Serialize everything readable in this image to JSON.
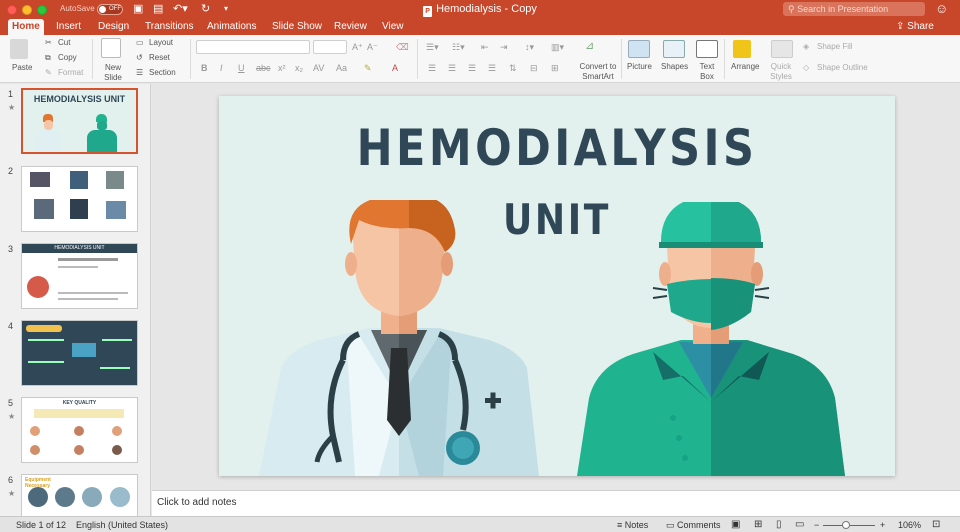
{
  "window": {
    "title": "Hemodialysis - Copy",
    "autosave_label": "AutoSave",
    "autosave_state": "OFF",
    "search_placeholder": "Search in Presentation"
  },
  "tabs": [
    "Home",
    "Insert",
    "Design",
    "Transitions",
    "Animations",
    "Slide Show",
    "Review",
    "View"
  ],
  "share_label": "Share",
  "ribbon": {
    "paste": "Paste",
    "cut": "Cut",
    "copy": "Copy",
    "format": "Format",
    "new_slide": "New Slide",
    "layout": "Layout",
    "reset": "Reset",
    "section": "Section",
    "convert_smartart": "Convert to SmartArt",
    "picture": "Picture",
    "shapes": "Shapes",
    "text_box": "Text Box",
    "arrange": "Arrange",
    "quick_styles": "Quick Styles",
    "shape_fill": "Shape Fill",
    "shape_outline": "Shape Outline"
  },
  "thumbnails": [
    {
      "num": "1",
      "title": "HEMODIALYSIS UNIT"
    },
    {
      "num": "2",
      "title": ""
    },
    {
      "num": "3",
      "title": "HEMODIALYSIS UNIT"
    },
    {
      "num": "4",
      "title": ""
    },
    {
      "num": "5",
      "title": "KEY QUALITY"
    },
    {
      "num": "6",
      "title": "Equipment Necessary"
    }
  ],
  "slide": {
    "title": "HEMODIALYSIS",
    "subtitle": "UNIT"
  },
  "notes_placeholder": "Click to add notes",
  "status": {
    "slide_info": "Slide 1 of 12",
    "language": "English (United States)",
    "notes": "Notes",
    "comments": "Comments",
    "zoom": "106%"
  },
  "colors": {
    "accent": "#c8462a",
    "slide_bg": "#e3f1ee",
    "title_text": "#2f4756",
    "doctor_hair": "#e0762f",
    "surgeon_green": "#1fa88c"
  }
}
